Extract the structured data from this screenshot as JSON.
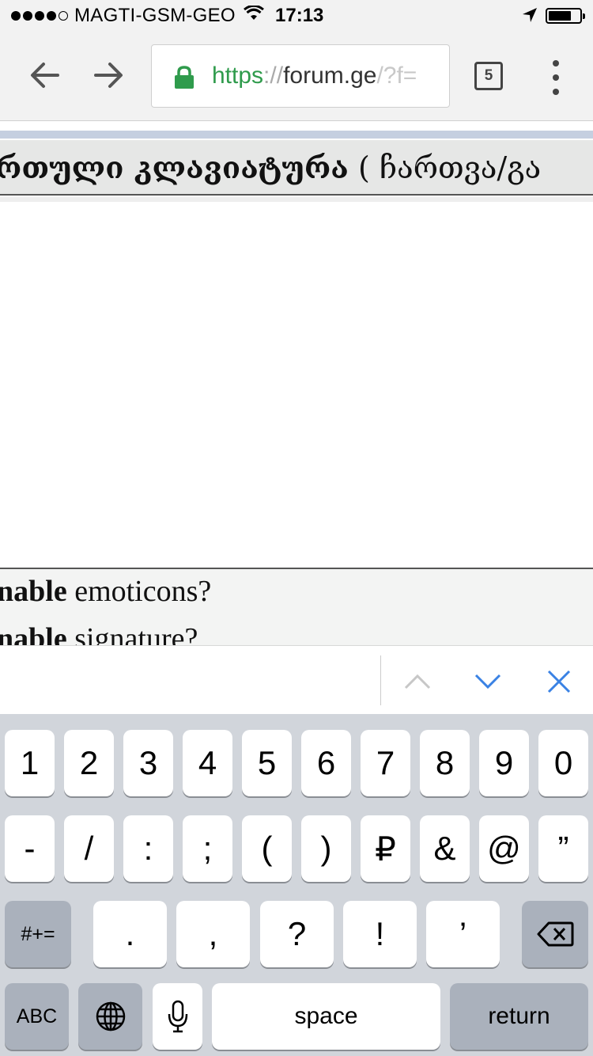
{
  "status_bar": {
    "carrier": "MAGTI-GSM-GEO",
    "time": "17:13",
    "signal_bars_filled": 4,
    "signal_bars_total": 5
  },
  "browser": {
    "url": {
      "scheme": "https",
      "separator": "://",
      "host": "forum.ge",
      "path": "/?f="
    },
    "tab_count": "5"
  },
  "page": {
    "title_bold": "რთული კლავიატურა",
    "title_rest": "( ჩართვა/გა",
    "options": [
      {
        "bold": "nable",
        "text": " emoticons?"
      },
      {
        "bold": "nable",
        "text": " signature?"
      }
    ]
  },
  "keyboard": {
    "row1": [
      "1",
      "2",
      "3",
      "4",
      "5",
      "6",
      "7",
      "8",
      "9",
      "0"
    ],
    "row2": [
      "-",
      "/",
      ":",
      ";",
      "(",
      ")",
      "₽",
      "&",
      "@",
      "”"
    ],
    "row3_left": "#+=",
    "row3": [
      ".",
      ",",
      "?",
      "!",
      "’"
    ],
    "abc": "ABC",
    "space": "space",
    "return": "return"
  },
  "colors": {
    "url_scheme": "#2f9b4c",
    "find_accent": "#3a82e4",
    "keyboard_bg": "#d1d5db"
  }
}
